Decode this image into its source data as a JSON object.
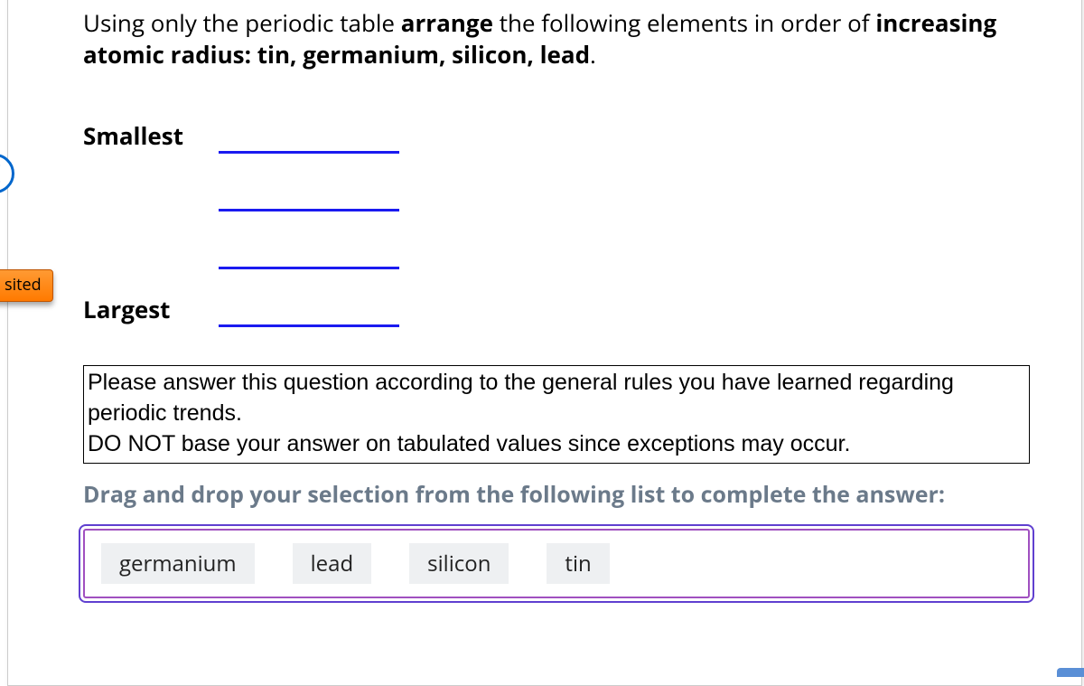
{
  "question": {
    "prefix": "Using only the periodic table ",
    "bold1": "arrange",
    "mid": " the following elements in order of ",
    "bold2": "increasing atomic radius: tin, germanium, silicon, lead",
    "suffix": "."
  },
  "labels": {
    "smallest": "Smallest",
    "largest": "Largest"
  },
  "hint": {
    "line1": "Please answer this question according to the general rules you have learned regarding periodic trends.",
    "line2": "DO NOT base your answer on tabulated values since exceptions may occur."
  },
  "drag_instruction": "Drag and drop your selection from the following list to complete the answer:",
  "chips": {
    "c0": "germanium",
    "c1": "lead",
    "c2": "silicon",
    "c3": "tin"
  },
  "left_tag": "sited"
}
